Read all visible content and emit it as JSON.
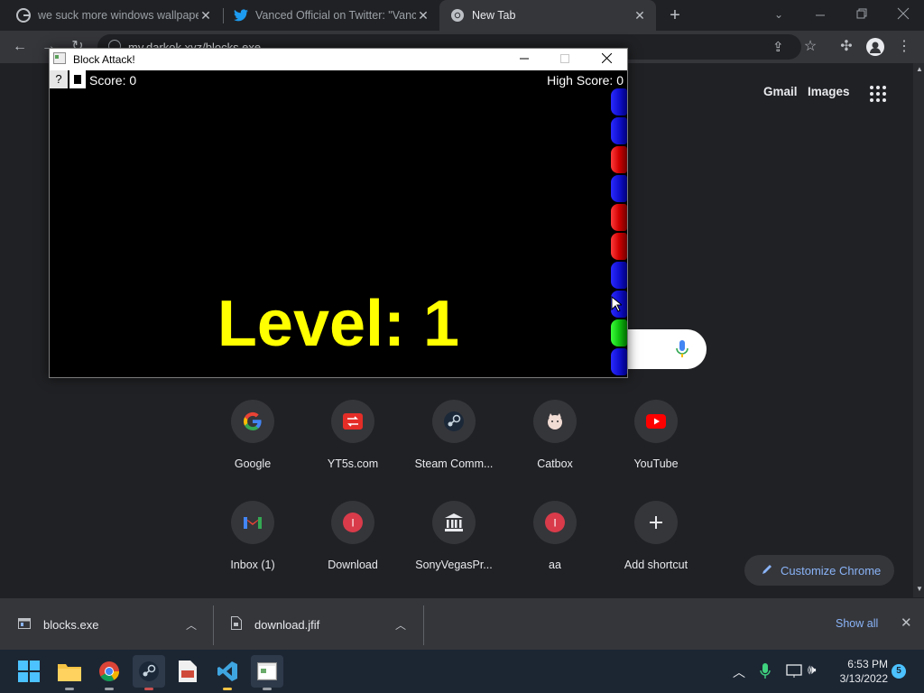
{
  "browser": {
    "tabs": [
      {
        "title": "we suck more windows wallpape",
        "favicon": "google-g-icon",
        "active": false
      },
      {
        "title": "Vanced Official on Twitter: \"Vanc",
        "favicon": "twitter-icon",
        "active": false
      },
      {
        "title": "New Tab",
        "favicon": "chrome-icon",
        "active": true
      }
    ],
    "url_text": "my.darkok.xyz/blocks.exe"
  },
  "ntp": {
    "gmail_label": "Gmail",
    "images_label": "Images",
    "shortcuts": [
      {
        "label": "Google",
        "icon": "google-g-icon"
      },
      {
        "label": "YT5s.com",
        "icon": "yt5s-icon"
      },
      {
        "label": "Steam Comm...",
        "icon": "steam-icon"
      },
      {
        "label": "Catbox",
        "icon": "catbox-icon"
      },
      {
        "label": "YouTube",
        "icon": "youtube-icon"
      },
      {
        "label": "Inbox (1)",
        "icon": "gmail-icon"
      },
      {
        "label": "Download",
        "icon": "letter-i-icon"
      },
      {
        "label": "SonyVegasPr...",
        "icon": "museum-icon"
      },
      {
        "label": "aa",
        "icon": "letter-i-icon"
      },
      {
        "label": "Add shortcut",
        "icon": "plus-icon"
      }
    ],
    "customize_label": "Customize Chrome"
  },
  "downloads": {
    "items": [
      {
        "name": "blocks.exe"
      },
      {
        "name": "download.jfif"
      }
    ],
    "show_all_label": "Show all"
  },
  "game": {
    "window_title": "Block Attack!",
    "help_label": "?",
    "score_label": "Score: 0",
    "high_score_label": "High Score: 0",
    "level_text": "Level: 1",
    "level_color": "#ffff00",
    "column_blocks": [
      "blue",
      "blue",
      "red",
      "blue",
      "red",
      "red",
      "blue",
      "blue",
      "green",
      "blue"
    ]
  },
  "taskbar": {
    "apps": [
      "windows-start-icon",
      "file-explorer-icon",
      "chrome-icon",
      "steam-icon",
      "document-icon",
      "visual-studio-icon",
      "block-attack-icon"
    ],
    "time": "6:53 PM",
    "date": "3/13/2022",
    "notification_count": "5"
  }
}
